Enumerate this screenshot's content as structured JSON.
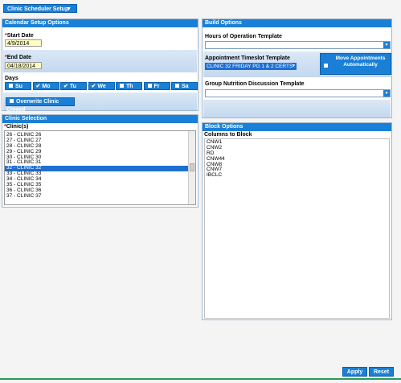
{
  "top_menu": {
    "label": "Clinic Scheduler Setup",
    "caret": "▼"
  },
  "calendar_setup": {
    "title": "Calendar Setup Options",
    "start_date_label": "Start Date",
    "start_date_value": "4/9/2014",
    "end_date_label": "End Date",
    "end_date_value": "04/18/2014",
    "days_label": "Days",
    "days": [
      {
        "label": "Su",
        "checked": false
      },
      {
        "label": "Mo",
        "checked": true
      },
      {
        "label": "Tu",
        "checked": true
      },
      {
        "label": "We",
        "checked": true
      },
      {
        "label": "Th",
        "checked": false
      },
      {
        "label": "Fr",
        "checked": false
      },
      {
        "label": "Sa",
        "checked": false
      }
    ],
    "overwrite_label": "Overwrite Clinic Closed"
  },
  "build_options": {
    "title": "Build Options",
    "hours_label": "Hours of Operation Template",
    "hours_value": "",
    "timeslot_label": "Appointment Timeslot Template",
    "timeslot_value": "CLINIC 32 FRIDAY PG 1 & 2 CERTS",
    "move_label": "Move Appointments Automatically",
    "nutrition_label": "Group Nutrition Discussion Template",
    "nutrition_value": ""
  },
  "clinic_selection": {
    "title": "Clinic Selection",
    "clinics_label": "Clinic(s)",
    "items": [
      "26 - CLINIC 26",
      "27 - CLINIC 27",
      "28 - CLINIC 28",
      "29 - CLINIC 29",
      "30 - CLINIC 30",
      "31 - CLINIC 31",
      "32 - CLINIC 32",
      "33 - CLINIC 33",
      "34 - CLINIC 34",
      "35 - CLINIC 35",
      "36 - CLINIC 36",
      "37 - CLINIC 37"
    ],
    "selected_index": 6
  },
  "block_options": {
    "title": "Block Options",
    "columns_label": "Columns to Block",
    "items": [
      "CNW1",
      "CNW2",
      "RD",
      "CNW44",
      "CNW8",
      "CNW7",
      "IBCLC"
    ]
  },
  "footer": {
    "apply": "Apply",
    "reset": "Reset"
  }
}
